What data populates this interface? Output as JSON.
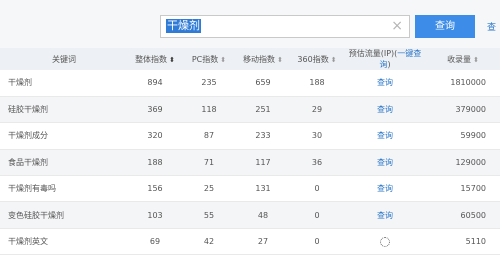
{
  "search": {
    "query": "干燥剂",
    "clear_icon": "×",
    "button_label": "查询",
    "extra_link": "查"
  },
  "table": {
    "headers": {
      "keyword": "关键词",
      "overall": "整体指数",
      "pc": "PC指数",
      "mobile": "移动指数",
      "s360": "360指数",
      "traffic": "预估流量(IP)",
      "traffic_link": "一键查询",
      "volume": "收录量"
    },
    "rows": [
      {
        "keyword": "干燥剂",
        "overall": "894",
        "pc": "235",
        "mobile": "659",
        "s360": "188",
        "traffic": "查询",
        "volume": "1810000"
      },
      {
        "keyword": "硅胶干燥剂",
        "overall": "369",
        "pc": "118",
        "mobile": "251",
        "s360": "29",
        "traffic": "查询",
        "volume": "379000"
      },
      {
        "keyword": "干燥剂成分",
        "overall": "320",
        "pc": "87",
        "mobile": "233",
        "s360": "30",
        "traffic": "查询",
        "volume": "59900"
      },
      {
        "keyword": "食品干燥剂",
        "overall": "188",
        "pc": "71",
        "mobile": "117",
        "s360": "36",
        "traffic": "查询",
        "volume": "129000"
      },
      {
        "keyword": "干燥剂有毒吗",
        "overall": "156",
        "pc": "25",
        "mobile": "131",
        "s360": "0",
        "traffic": "查询",
        "volume": "15700"
      },
      {
        "keyword": "变色硅胶干燥剂",
        "overall": "103",
        "pc": "55",
        "mobile": "48",
        "s360": "0",
        "traffic": "查询",
        "volume": "60500"
      },
      {
        "keyword": "干燥剂英文",
        "overall": "69",
        "pc": "42",
        "mobile": "27",
        "s360": "0",
        "traffic": "",
        "volume": "5110"
      }
    ]
  },
  "colors": {
    "accent": "#3d8de8",
    "link": "#2d78c9",
    "header_bg": "#edf0f4"
  }
}
